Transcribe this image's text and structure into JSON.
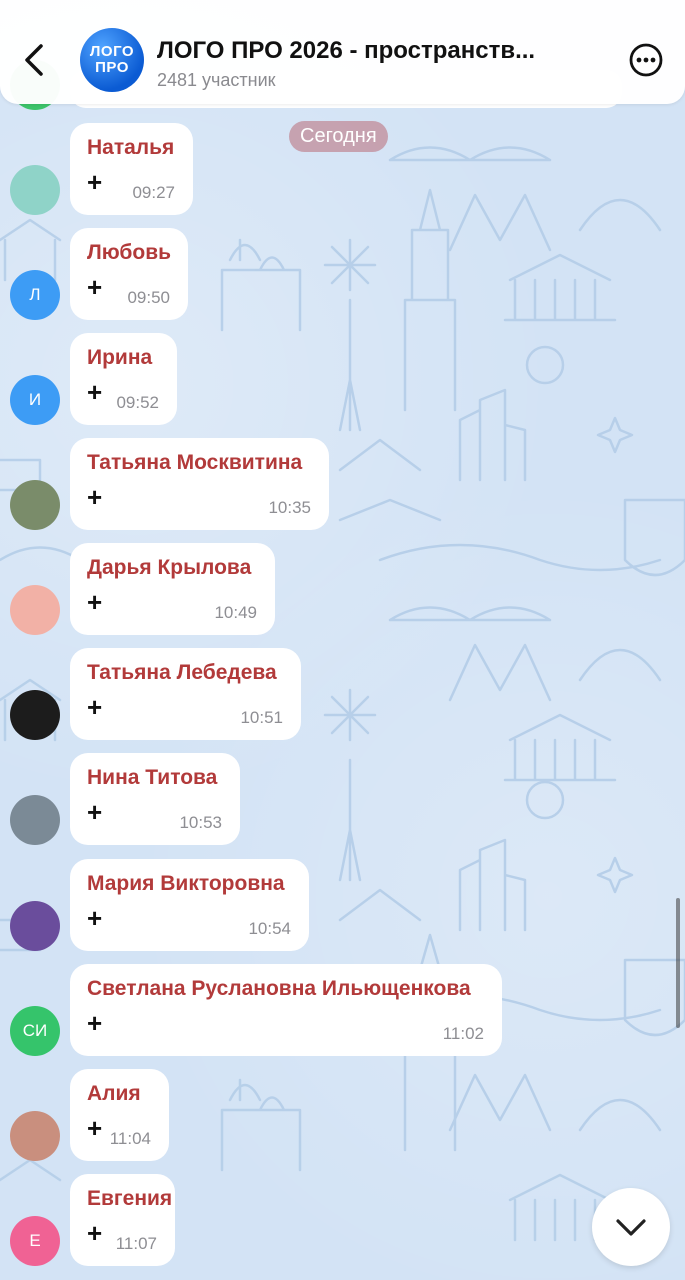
{
  "header": {
    "logo_line1": "ЛОГО",
    "logo_line2": "ПРО",
    "title": "ЛОГО ПРО 2026 - пространств...",
    "subtitle": "2481 участник"
  },
  "date_separator": "Сегодня",
  "messages": [
    {
      "sender": "Наталья",
      "text": "+",
      "time": "09:27",
      "avatar_letter": "",
      "avatar_color": "#8fd3c8"
    },
    {
      "sender": "Любовь",
      "text": "+",
      "time": "09:50",
      "avatar_letter": "Л",
      "avatar_color": "#3d9cf5"
    },
    {
      "sender": "Ирина",
      "text": "+",
      "time": "09:52",
      "avatar_letter": "И",
      "avatar_color": "#3d9cf5"
    },
    {
      "sender": "Татьяна Москвитина",
      "text": "+",
      "time": "10:35",
      "avatar_letter": "",
      "avatar_color": "#7a8c6a"
    },
    {
      "sender": "Дарья Крылова",
      "text": "+",
      "time": "10:49",
      "avatar_letter": "",
      "avatar_color": "#f2b1a6"
    },
    {
      "sender": "Татьяна Лебедева",
      "text": "+",
      "time": "10:51",
      "avatar_letter": "",
      "avatar_color": "#1c1c1c"
    },
    {
      "sender": "Нина Титова",
      "text": "+",
      "time": "10:53",
      "avatar_letter": "",
      "avatar_color": "#7b8a96"
    },
    {
      "sender": "Мария Викторовна",
      "text": "+",
      "time": "10:54",
      "avatar_letter": "",
      "avatar_color": "#6a4d9c"
    },
    {
      "sender": "Светлана Руслановна Ильющенкова",
      "text": "+",
      "time": "11:02",
      "avatar_letter": "СИ",
      "avatar_color": "#35c46b"
    },
    {
      "sender": "Алия",
      "text": "+",
      "time": "11:04",
      "avatar_letter": "",
      "avatar_color": "#c98f7e"
    },
    {
      "sender": "Евгения",
      "text": "+",
      "time": "11:07",
      "avatar_letter": "Е",
      "avatar_color": "#f06294"
    }
  ],
  "icons": {
    "back": "chevron-left-icon",
    "more": "more-circle-icon",
    "scroll_down": "chevron-down-icon"
  }
}
